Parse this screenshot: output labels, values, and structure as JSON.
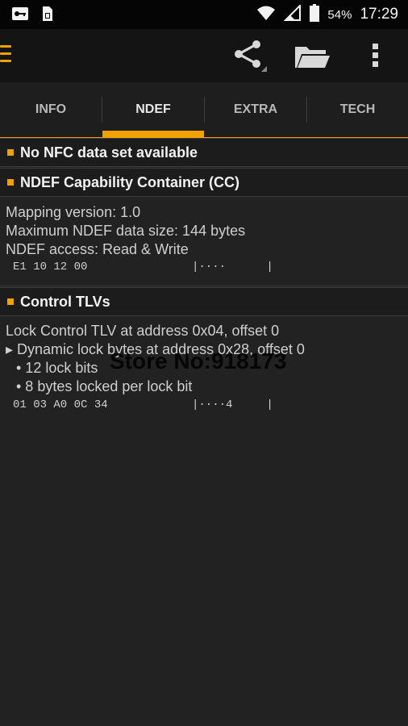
{
  "status_bar": {
    "left_icons": [
      "vpn-key-icon",
      "sim-card-icon"
    ],
    "battery": "54%",
    "time": "17:29"
  },
  "toolbar": {
    "icons": [
      "menu-icon",
      "share-icon",
      "folder-icon",
      "more-vert-icon"
    ]
  },
  "tabs": [
    {
      "label": "INFO",
      "active": false
    },
    {
      "label": "NDEF",
      "active": true
    },
    {
      "label": "EXTRA",
      "active": false
    },
    {
      "label": "TECH",
      "active": false
    }
  ],
  "sections": {
    "no_data": {
      "title": "No NFC data set available"
    },
    "cc": {
      "title": "NDEF Capability Container (CC)",
      "lines": [
        "Mapping version: 1.0",
        "Maximum NDEF data size: 144 bytes",
        "NDEF access: Read & Write"
      ],
      "hex": "E1 10 12 00",
      "ascii": "|····      |"
    },
    "tlv": {
      "title": "Control TLVs",
      "lines": [
        "Lock Control TLV at address 0x04, offset 0",
        "▸ Dynamic lock bytes at address 0x28, offset 0",
        "• 12 lock bits",
        "• 8 bytes locked per lock bit"
      ],
      "hex": "01 03 A0 0C 34",
      "ascii": "|····4     |"
    }
  },
  "watermark": "Store No:918173",
  "colors": {
    "accent": "#f0a300",
    "background": "#222222",
    "toolbar": "#141414"
  }
}
